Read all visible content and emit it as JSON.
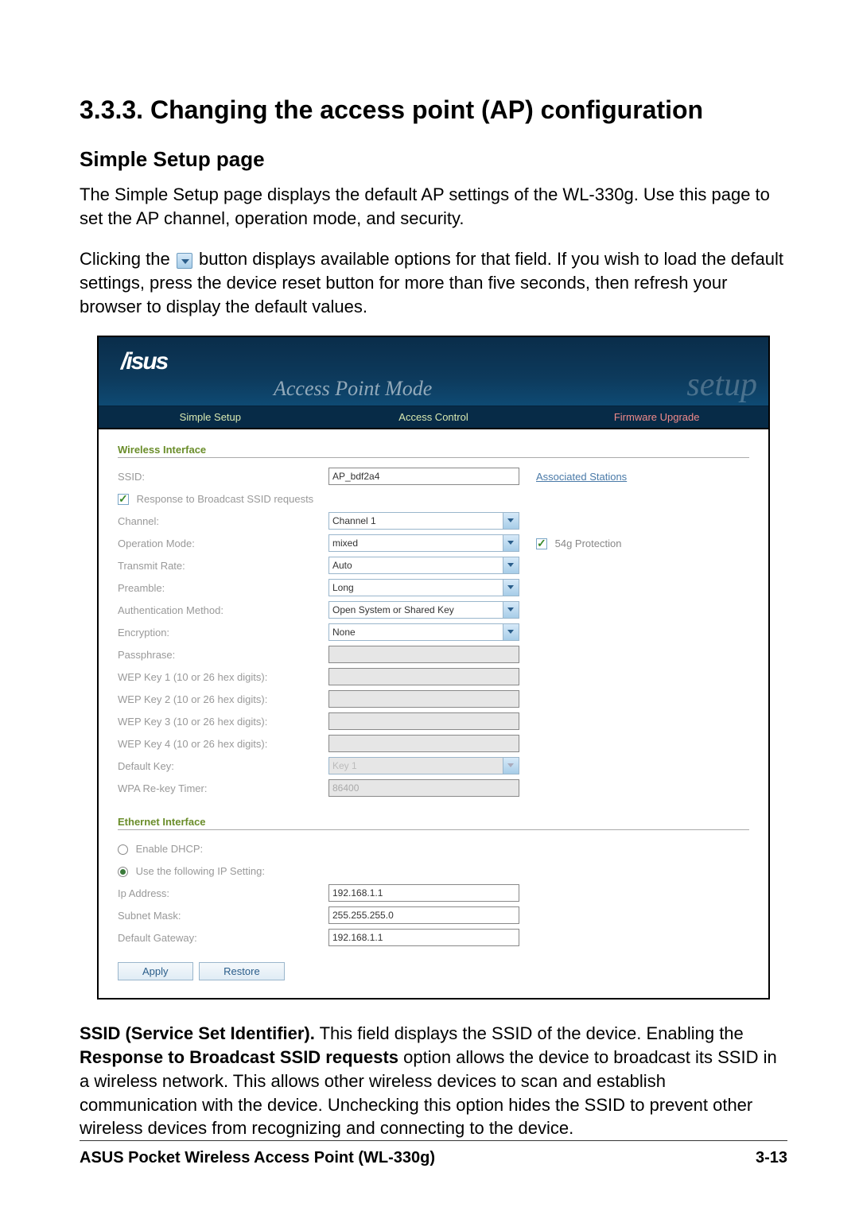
{
  "section_number": "3.3.3.",
  "section_title": "Changing the access point (AP) configuration",
  "subheading": "Simple Setup page",
  "para1": "The Simple Setup page displays the default AP settings of the WL-330g. Use this page to set the AP channel, operation mode, and security.",
  "para2_a": "Clicking the ",
  "para2_b": " button displays available options for that field. If you wish to load the default settings, press the device reset button for more than five seconds, then refresh your browser to display the default values.",
  "ssid_para_bold1": "SSID (Service Set Identifier).",
  "ssid_para_t1": " This field displays the SSID of the device. Enabling the ",
  "ssid_para_bold2": "Response to Broadcast SSID requests",
  "ssid_para_t2": " option allows the device to broadcast its SSID in a wireless network. This allows other wireless devices to scan and establish communication with the device. Unchecking this option hides the SSID to prevent other wireless devices from recognizing and connecting to the device.",
  "footer_left": "ASUS Pocket Wireless Access Point (WL-330g)",
  "footer_right": "3-13",
  "ui": {
    "logo": "/isus",
    "header_sub": "Access Point Mode",
    "header_wm": "setup",
    "tabs": [
      "Simple Setup",
      "Access Control",
      "Firmware Upgrade"
    ],
    "wireless_header": "Wireless Interface",
    "ethernet_header": "Ethernet Interface",
    "labels": {
      "ssid": "SSID:",
      "response": "Response to Broadcast SSID requests",
      "channel": "Channel:",
      "opmode": "Operation Mode:",
      "txrate": "Transmit Rate:",
      "preamble": "Preamble:",
      "auth": "Authentication Method:",
      "enc": "Encryption:",
      "pass": "Passphrase:",
      "wep1": "WEP Key 1 (10 or 26 hex digits):",
      "wep2": "WEP Key 2 (10 or 26 hex digits):",
      "wep3": "WEP Key 3 (10 or 26 hex digits):",
      "wep4": "WEP Key 4 (10 or 26 hex digits):",
      "defkey": "Default Key:",
      "wpa": "WPA Re-key Timer:",
      "dhcp": "Enable DHCP:",
      "ipset": "Use the following IP Setting:",
      "ip": "Ip Address:",
      "mask": "Subnet Mask:",
      "gw": "Default Gateway:"
    },
    "values": {
      "ssid": "AP_bdf2a4",
      "channel": "Channel 1",
      "opmode": "mixed",
      "txrate": "Auto",
      "preamble": "Long",
      "auth": "Open System or Shared Key",
      "enc": "None",
      "defkey": "Key 1",
      "wpa": "86400",
      "ip": "192.168.1.1",
      "mask": "255.255.255.0",
      "gw": "192.168.1.1"
    },
    "assoc_link": "Associated Stations",
    "protection": "54g Protection",
    "apply": "Apply",
    "restore": "Restore"
  }
}
